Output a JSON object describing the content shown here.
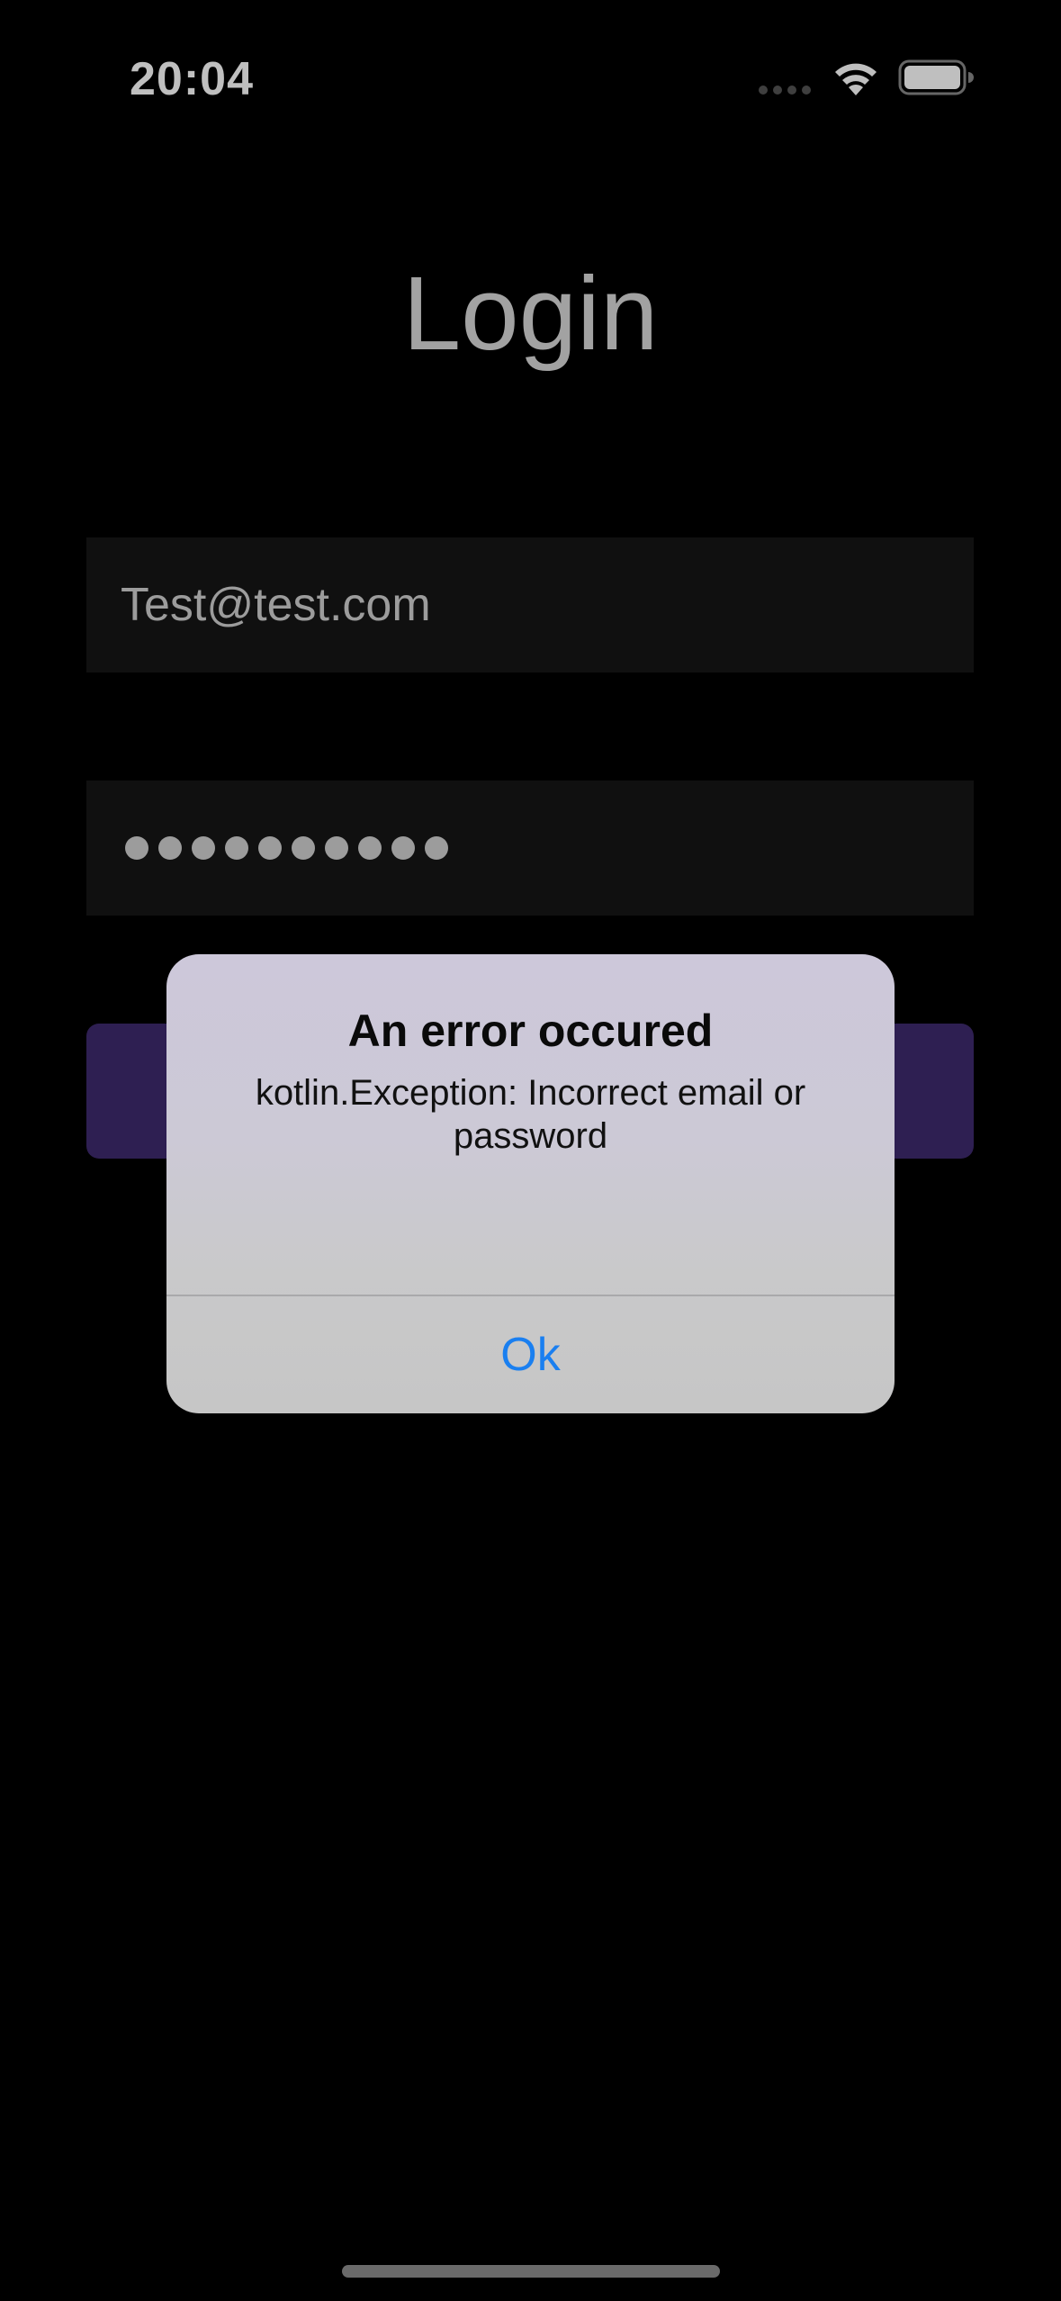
{
  "status_bar": {
    "time": "20:04",
    "signal_icon": "signal-dots-icon",
    "wifi_icon": "wifi-icon",
    "battery_icon": "battery-icon"
  },
  "login": {
    "title": "Login",
    "email_value": "Test@test.com",
    "password_value": "••••••••••",
    "password_dot_count": 10,
    "login_button_label": "",
    "login_button_color": "#3e2a6e"
  },
  "alert": {
    "title": "An error occured",
    "message": "kotlin.Exception: Incorrect email or password",
    "ok_label": "Ok",
    "ok_color": "#1a7ff0"
  }
}
